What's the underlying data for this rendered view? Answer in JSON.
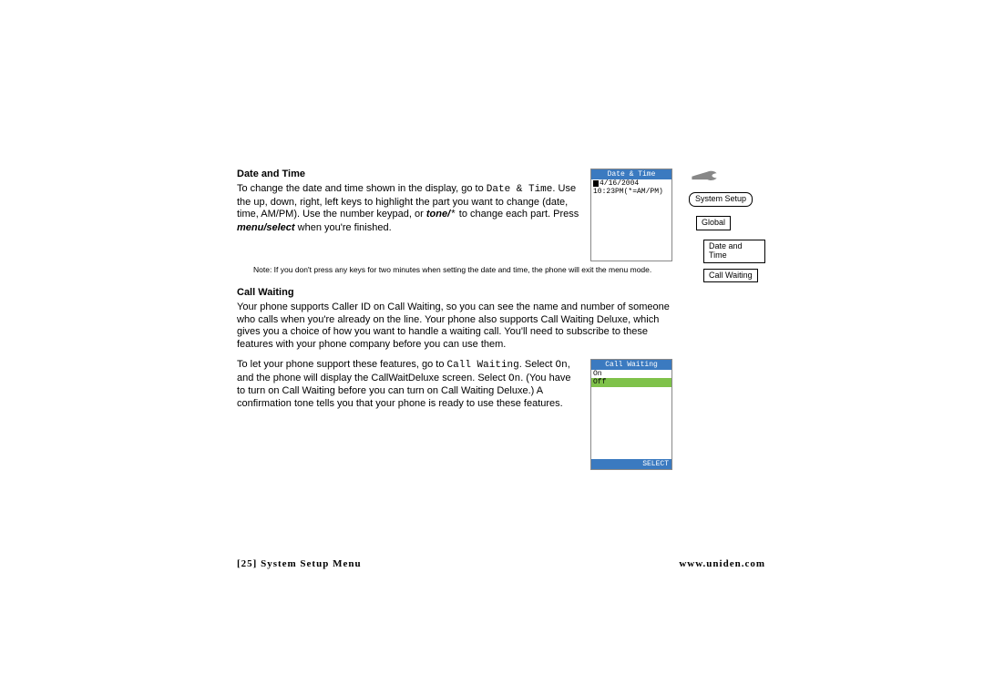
{
  "section1": {
    "heading": "Date and Time",
    "p1a": "To change the date and time shown in the display, go to ",
    "p1mono": "Date & Time",
    "p1b": ". Use the up, down, right, left keys to highlight the part you want to change (date, time, AM/PM). Use the number keypad, or ",
    "p1tone": "tone/",
    "p1star": "*",
    "p1c": " to change each part. Press ",
    "p1menu": "menu/select",
    "p1d": " when you're finished.",
    "note": "Note: If you don't press any keys for two minutes when setting the date and time, the phone will exit the menu mode."
  },
  "screen1": {
    "title": "Date & Time",
    "line1": "4/16/2004",
    "line2": "10:23PM(*=AM/PM)"
  },
  "section2": {
    "heading": "Call Waiting",
    "p1": "Your phone supports Caller ID on Call Waiting, so you can see the name and number of someone who calls when you're already on the line. Your phone also supports Call Waiting Deluxe, which gives you a choice of how you want to handle a waiting call. You'll need to subscribe to these features with your phone company before you can use them.",
    "p2a": "To let your phone support these features, go to ",
    "p2mono1": "Call Waiting",
    "p2b": ". Select ",
    "p2mono2": "On",
    "p2c": ", and the phone will display the CallWaitDeluxe screen. Select ",
    "p2mono3": "On",
    "p2d": ". (You have to turn on Call Waiting before you can turn on Call Waiting Deluxe.) A confirmation tone tells you that your phone is ready to use these features."
  },
  "screen2": {
    "title": "Call Waiting",
    "opt1": "On",
    "opt2": "Off",
    "select": "SELECT"
  },
  "nav": {
    "root": "System Setup",
    "a": "Global",
    "b": "Date and Time",
    "c": "Call Waiting"
  },
  "footer": {
    "left": "[25] System Setup Menu",
    "right": "www.uniden.com"
  }
}
